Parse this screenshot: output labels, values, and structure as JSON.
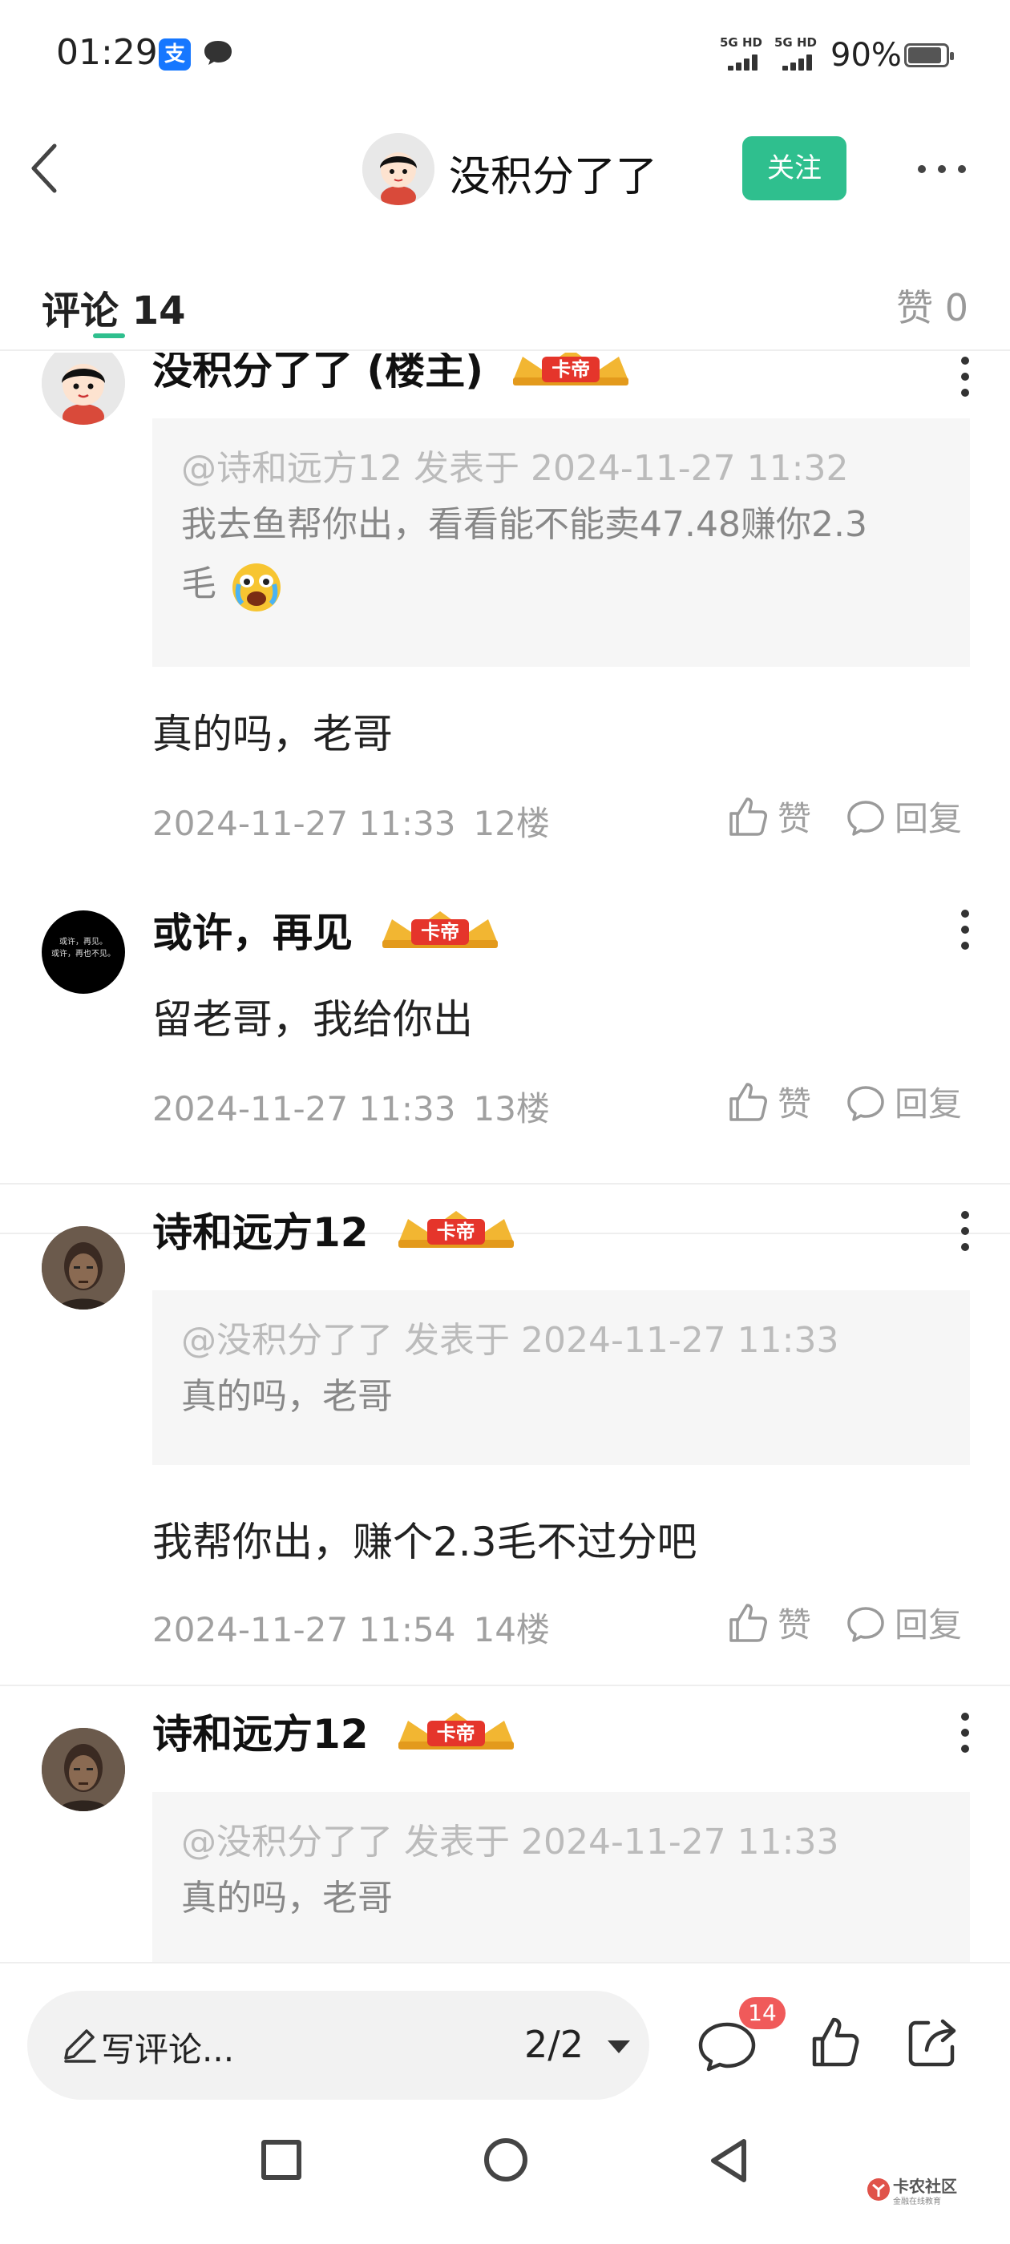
{
  "status_bar": {
    "time": "01:29",
    "alipay_glyph": "支",
    "signal_1_label": "5G HD",
    "signal_2_label": "5G HD",
    "battery_percent": "90%",
    "battery_level": 0.9,
    "icons": [
      "alipay-icon",
      "chat-bubble-icon",
      "signal-icon",
      "battery-icon"
    ]
  },
  "header": {
    "title": "没积分了了",
    "follow_label": "关注",
    "accent_color": "#2fbf8e"
  },
  "tabs": {
    "comment_label": "评论",
    "comment_count": "14",
    "like_label": "赞",
    "like_count": "0"
  },
  "comments": [
    {
      "author": "没积分了了 (楼主)",
      "badge": "卡帝",
      "quote_meta": "@诗和远方12 发表于 2024-11-27 11:32",
      "quote_line1": "我去鱼帮你出，看看能不能卖47.48赚你2.3",
      "quote_line2": "毛",
      "text": "真的吗，老哥",
      "time": "2024-11-27 11:33",
      "floor": "12楼",
      "like_label": "赞",
      "reply_label": "回复"
    },
    {
      "author": "或许，再见",
      "badge": "卡帝",
      "avatar_text_1": "或许，再见。",
      "avatar_text_2": "或许，再也不见。",
      "text": "留老哥，我给你出",
      "time": "2024-11-27 11:33",
      "floor": "13楼",
      "like_label": "赞",
      "reply_label": "回复"
    },
    {
      "author": "诗和远方12",
      "badge": "卡帝",
      "quote_meta": "@没积分了了 发表于 2024-11-27 11:33",
      "quote_text": "真的吗，老哥",
      "text": "我帮你出，赚个2.3毛不过分吧",
      "time": "2024-11-27 11:54",
      "floor": "14楼",
      "like_label": "赞",
      "reply_label": "回复"
    },
    {
      "author": "诗和远方12",
      "badge": "卡帝",
      "quote_meta": "@没积分了了 发表于 2024-11-27 11:33",
      "quote_text": "真的吗，老哥"
    }
  ],
  "bottom_bar": {
    "input_placeholder": "写评论...",
    "page_indicator": "2/2",
    "comment_badge": "14"
  },
  "watermark": {
    "title": "卡农社区",
    "subtitle": "金融在线教育"
  }
}
